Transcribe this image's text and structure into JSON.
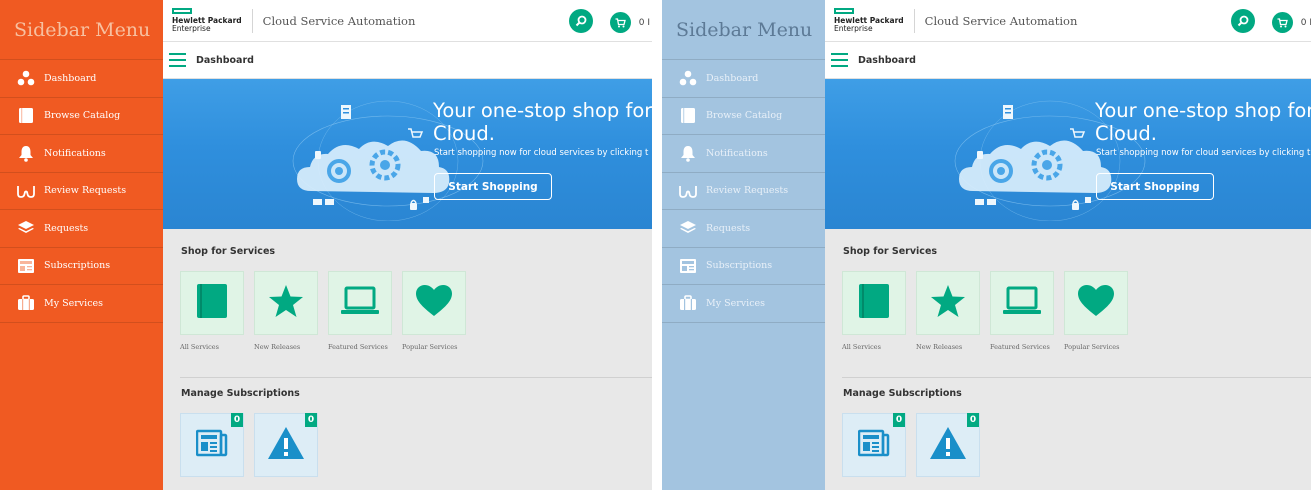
{
  "sidebar": {
    "title": "Sidebar Menu",
    "items": [
      {
        "label": "Dashboard",
        "icon": "dashboard-dots-icon"
      },
      {
        "label": "Browse Catalog",
        "icon": "book-icon"
      },
      {
        "label": "Notifications",
        "icon": "bell-icon"
      },
      {
        "label": "Review Requests",
        "icon": "glasses-icon"
      },
      {
        "label": "Requests",
        "icon": "layers-icon"
      },
      {
        "label": "Subscriptions",
        "icon": "newspaper-icon"
      },
      {
        "label": "My Services",
        "icon": "briefcase-icon"
      }
    ]
  },
  "header": {
    "brand_line1": "Hewlett Packard",
    "brand_line2": "Enterprise",
    "app_title": "Cloud Service Automation",
    "cart_count": "0 I"
  },
  "breadcrumb": "Dashboard",
  "banner": {
    "title_line1": "Your one-stop shop for a",
    "title_line2": "Cloud.",
    "subtitle": "Start shopping now for cloud services by clicking t",
    "button_label": "Start Shopping"
  },
  "shop": {
    "title": "Shop for Services",
    "tiles": [
      {
        "label": "All Services",
        "icon": "book-icon"
      },
      {
        "label": "New Releases",
        "icon": "star-icon"
      },
      {
        "label": "Featured Services",
        "icon": "laptop-icon"
      },
      {
        "label": "Popular Services",
        "icon": "heart-icon"
      }
    ]
  },
  "subscriptions": {
    "title": "Manage Subscriptions",
    "tiles": [
      {
        "badge": "0",
        "icon": "newspaper-icon"
      },
      {
        "badge": "0",
        "icon": "warning-icon"
      }
    ]
  },
  "colors": {
    "accent_green": "#01a982",
    "sidebar_orange": "#f05a22",
    "sidebar_blue": "#a3c4e0",
    "tile_blue": "#1a8fc9"
  }
}
